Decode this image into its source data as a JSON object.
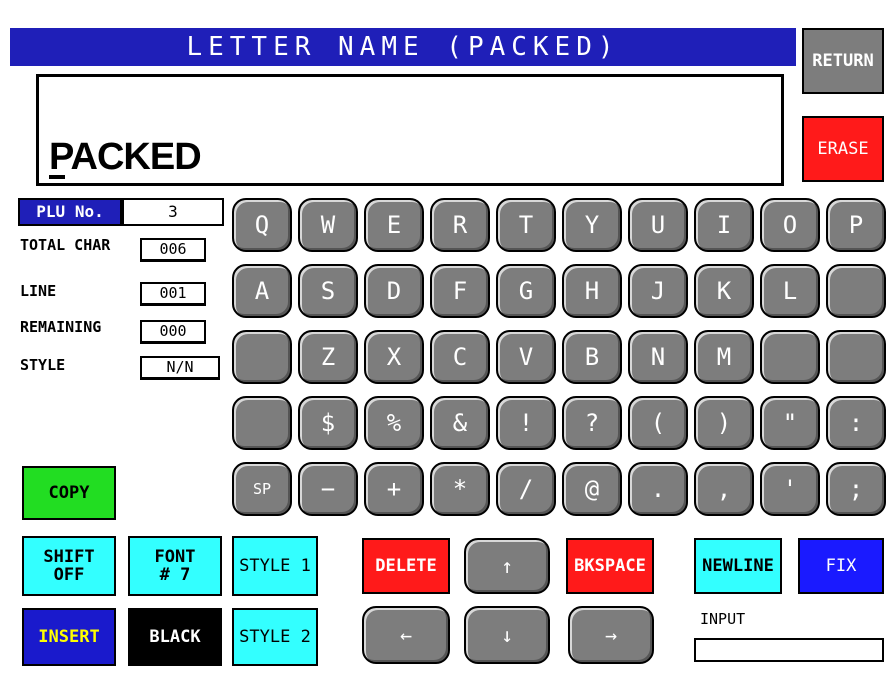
{
  "header": {
    "title": "LETTER NAME (PACKED)"
  },
  "editor": {
    "text": "PACKED"
  },
  "side": {
    "return_label": "RETURN",
    "erase_label": "ERASE"
  },
  "info": {
    "plu_label": "PLU No.",
    "plu_value": "3",
    "total_char_label": "TOTAL CHAR",
    "total_char_value": "006",
    "line_label": "LINE",
    "line_value": "001",
    "remaining_label": "REMAINING",
    "remaining_value": "000",
    "style_label": "STYLE",
    "style_value": "N/N"
  },
  "keyboard": {
    "row1": [
      "Q",
      "W",
      "E",
      "R",
      "T",
      "Y",
      "U",
      "I",
      "O",
      "P"
    ],
    "row2": [
      "A",
      "S",
      "D",
      "F",
      "G",
      "H",
      "J",
      "K",
      "L",
      ""
    ],
    "row3": [
      "",
      "Z",
      "X",
      "C",
      "V",
      "B",
      "N",
      "M",
      "",
      ""
    ],
    "row4": [
      "",
      "$",
      "%",
      "&",
      "!",
      "?",
      "(",
      ")",
      "\"",
      ":"
    ],
    "row5": [
      "SP",
      "−",
      "+",
      "*",
      "/",
      "@",
      ".",
      ",",
      "'",
      ";"
    ]
  },
  "controls": {
    "copy": "COPY",
    "shift": "SHIFT\nOFF",
    "font": "FONT\n# 7",
    "style1": "STYLE 1",
    "style2": "STYLE 2",
    "insert": "INSERT",
    "black": "BLACK",
    "delete": "DELETE",
    "bkspace": "BKSPACE",
    "newline": "NEWLINE",
    "fix": "FIX",
    "up": "↑",
    "down": "↓",
    "left": "←",
    "right": "→",
    "input_label": "INPUT",
    "input_value": ""
  },
  "colors": {
    "title_bg": "#1f1fb8",
    "key_gray": "#7d7d7d",
    "erase_red": "#ff1a1a",
    "copy_green": "#22dd22",
    "cyan": "#33ffff",
    "fix_blue": "#1a1aff",
    "insert_blue": "#1a1acc",
    "insert_text": "#ffff00"
  }
}
